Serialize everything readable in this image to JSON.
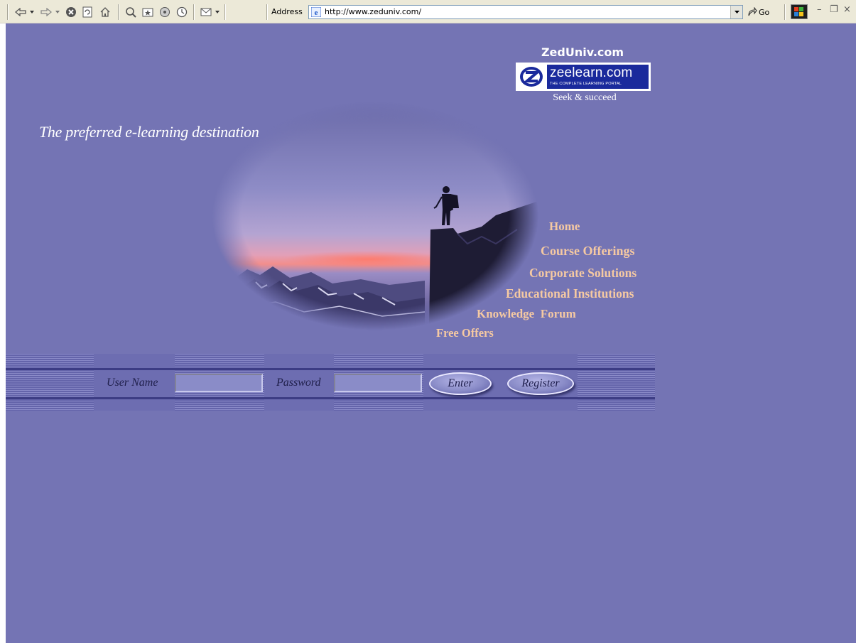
{
  "browser": {
    "address_label": "Address",
    "url": "http://www.zeduniv.com/",
    "go_label": "Go",
    "icons": [
      "back-icon",
      "forward-icon",
      "stop-icon",
      "refresh-icon",
      "home-icon",
      "search-icon",
      "favorites-icon",
      "media-icon",
      "history-icon",
      "mail-icon",
      "ie-page-icon",
      "go-arrow-icon",
      "windows-logo-icon"
    ]
  },
  "site": {
    "logo_title": "ZedUniv.com",
    "logo_name": "zeelearn.com",
    "logo_subtitle": "THE COMPLETE LEARNING PORTAL",
    "logo_slogan": "Seek & succeed",
    "tagline": "The preferred e-learning destination"
  },
  "nav": {
    "items": [
      {
        "label": "Home"
      },
      {
        "label": "Course Offerings"
      },
      {
        "label": "Corporate Solutions"
      },
      {
        "label": "Educational Institutions"
      },
      {
        "label": "Knowledge  Forum"
      },
      {
        "label": "Free Offers"
      }
    ]
  },
  "login": {
    "username_label": "User Name",
    "password_label": "Password",
    "username_value": "",
    "password_value": "",
    "enter_label": "Enter",
    "register_label": "Register"
  },
  "colors": {
    "page_bg": "#7474b4",
    "nav_text": "#f5c9a2",
    "logo_panel": "#1a2a9c"
  }
}
